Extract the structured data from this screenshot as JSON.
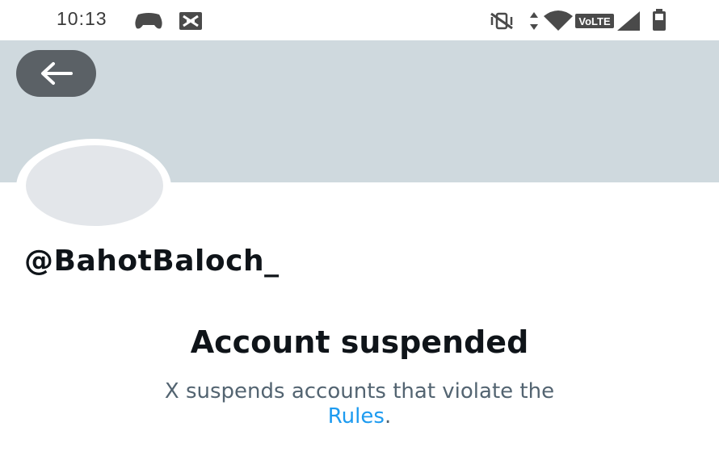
{
  "status_bar": {
    "time": "10:13",
    "network_type": "VoLTE",
    "icons": [
      "game-controller-icon",
      "data-saver-icon",
      "vibrate-off-icon",
      "data-arrows-icon",
      "wifi-icon",
      "volte-icon",
      "signal-icon",
      "battery-icon"
    ]
  },
  "header": {
    "back_icon": "arrow-left-icon"
  },
  "profile": {
    "handle": "@BahotBaloch_"
  },
  "suspension": {
    "title": "Account suspended",
    "message_before_link": "X suspends accounts that violate the",
    "link_text": "Rules",
    "message_after_link": "."
  },
  "colors": {
    "banner": "#cfd9de",
    "back_button": "#5b6166",
    "avatar": "#e3e6ea",
    "link": "#1d9bf0",
    "secondary_text": "#536471",
    "primary_text": "#0f1419"
  }
}
